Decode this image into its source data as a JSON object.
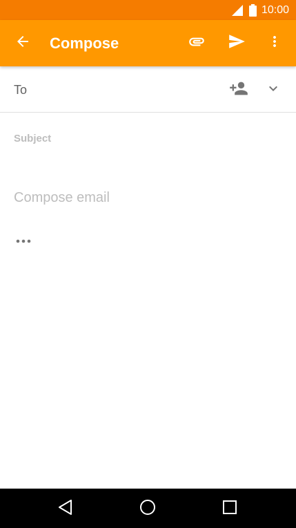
{
  "status_bar": {
    "time": "10:00",
    "icons": [
      "signal-icon",
      "battery-icon"
    ]
  },
  "app_bar": {
    "title": "Compose",
    "icons": [
      "arrow-back-icon",
      "paperclip-icon",
      "send-icon",
      "more-vert-icon"
    ]
  },
  "compose": {
    "to_label": "To",
    "to_value": "",
    "subject_placeholder": "Subject",
    "subject_value": "",
    "body_placeholder": "Compose email",
    "body_value": "",
    "row_icons": [
      "add-contact-icon",
      "chevron-down-icon",
      "more-horiz-icon"
    ]
  },
  "nav_bar": {
    "icons": [
      "nav-back-icon",
      "nav-home-icon",
      "nav-recents-icon"
    ]
  },
  "colors": {
    "status_bar": "#f57c00",
    "app_bar": "#ff9800",
    "app_bar_text": "#ffffff",
    "divider": "#e0e0e0",
    "secondary_text": "#616161",
    "hint_text": "#bdbdbd",
    "icon_gray": "#757575",
    "nav_bar": "#000000"
  }
}
